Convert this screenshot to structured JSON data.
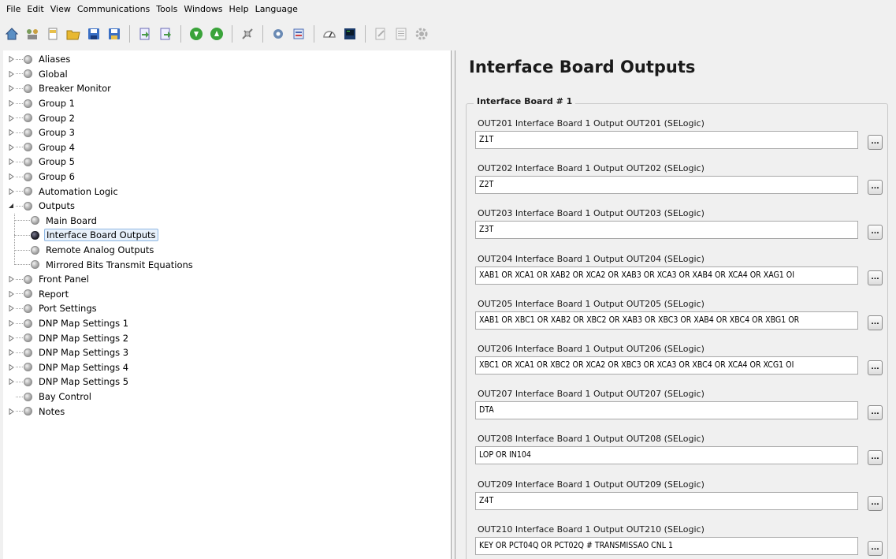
{
  "menu": [
    "File",
    "Edit",
    "View",
    "Communications",
    "Tools",
    "Windows",
    "Help",
    "Language"
  ],
  "toolbar": [
    {
      "icon": "home-icon",
      "color": "#5a8fc4"
    },
    {
      "icon": "network-icon",
      "color": "#7a9c5a"
    },
    {
      "icon": "new-document-icon",
      "color": "#e8c04a"
    },
    {
      "icon": "open-folder-icon",
      "color": "#e8b830"
    },
    {
      "icon": "save-icon",
      "color": "#3a6fc4"
    },
    {
      "icon": "save-as-icon",
      "color": "#3a6fc4"
    },
    {
      "icon": "import-icon",
      "color": "#4a9a4a"
    },
    {
      "icon": "export-icon",
      "color": "#4a9a4a"
    },
    {
      "icon": "download-icon",
      "color": "#3aa33a"
    },
    {
      "icon": "upload-icon",
      "color": "#3aa33a"
    },
    {
      "icon": "connect-icon",
      "color": "#7a7a7a"
    },
    {
      "icon": "settings-icon",
      "color": "#6a8ab4"
    },
    {
      "icon": "database-icon",
      "color": "#4a6ab4"
    },
    {
      "icon": "meter-icon",
      "color": "#8a8a8a"
    },
    {
      "icon": "terminal-icon",
      "color": "#1a3a6a"
    },
    {
      "icon": "report-icon",
      "color": "#b0b0b0"
    },
    {
      "icon": "list-icon",
      "color": "#b0b0b0"
    },
    {
      "icon": "gear-icon",
      "color": "#b0b0b0"
    }
  ],
  "tree": [
    {
      "label": "Aliases",
      "expander": "collapsed"
    },
    {
      "label": "Global",
      "expander": "collapsed"
    },
    {
      "label": "Breaker Monitor",
      "expander": "collapsed"
    },
    {
      "label": "Group 1",
      "expander": "collapsed"
    },
    {
      "label": "Group 2",
      "expander": "collapsed"
    },
    {
      "label": "Group 3",
      "expander": "collapsed"
    },
    {
      "label": "Group 4",
      "expander": "collapsed"
    },
    {
      "label": "Group 5",
      "expander": "collapsed"
    },
    {
      "label": "Group 6",
      "expander": "collapsed"
    },
    {
      "label": "Automation Logic",
      "expander": "collapsed"
    },
    {
      "label": "Outputs",
      "expander": "expanded"
    },
    {
      "label": "Main Board",
      "child": true
    },
    {
      "label": "Interface Board Outputs",
      "child": true,
      "selected": true
    },
    {
      "label": "Remote Analog Outputs",
      "child": true
    },
    {
      "label": "Mirrored Bits Transmit Equations",
      "child": true
    },
    {
      "label": "Front Panel",
      "expander": "collapsed"
    },
    {
      "label": "Report",
      "expander": "collapsed"
    },
    {
      "label": "Port Settings",
      "expander": "collapsed"
    },
    {
      "label": "DNP Map Settings 1",
      "expander": "collapsed"
    },
    {
      "label": "DNP Map Settings 2",
      "expander": "collapsed"
    },
    {
      "label": "DNP Map Settings 3",
      "expander": "collapsed"
    },
    {
      "label": "DNP Map Settings 4",
      "expander": "collapsed"
    },
    {
      "label": "DNP Map Settings 5",
      "expander": "collapsed"
    },
    {
      "label": "Bay Control",
      "expander": "none"
    },
    {
      "label": "Notes",
      "expander": "collapsed"
    }
  ],
  "page_title": "Interface Board Outputs",
  "group_title": "Interface Board # 1",
  "ellipsis_label": "...",
  "settings": [
    {
      "label": "OUT201  Interface Board 1 Output OUT201 (SELogic)",
      "value": "Z1T"
    },
    {
      "label": "OUT202  Interface Board 1 Output OUT202 (SELogic)",
      "value": "Z2T"
    },
    {
      "label": "OUT203  Interface Board 1 Output OUT203 (SELogic)",
      "value": "Z3T"
    },
    {
      "label": "OUT204  Interface Board 1 Output OUT204 (SELogic)",
      "value": "XAB1 OR XCA1 OR XAB2 OR XCA2 OR XAB3 OR XCA3 OR XAB4 OR XCA4 OR XAG1 OI"
    },
    {
      "label": "OUT205  Interface Board 1 Output OUT205 (SELogic)",
      "value": "XAB1 OR XBC1 OR XAB2 OR XBC2 OR XAB3 OR XBC3 OR XAB4 OR XBC4 OR XBG1 OR"
    },
    {
      "label": "OUT206  Interface Board 1 Output OUT206 (SELogic)",
      "value": "XBC1 OR XCA1 OR XBC2 OR XCA2 OR XBC3 OR XCA3 OR XBC4 OR XCA4 OR XCG1 OI"
    },
    {
      "label": "OUT207  Interface Board 1 Output OUT207 (SELogic)",
      "value": "DTA"
    },
    {
      "label": "OUT208  Interface Board 1 Output OUT208 (SELogic)",
      "value": "LOP OR IN104"
    },
    {
      "label": "OUT209  Interface Board 1 Output OUT209 (SELogic)",
      "value": "Z4T"
    },
    {
      "label": "OUT210  Interface Board 1 Output OUT210 (SELogic)",
      "value": "KEY OR PCT04Q OR PCT02Q # TRANSMISSAO CNL 1"
    }
  ]
}
